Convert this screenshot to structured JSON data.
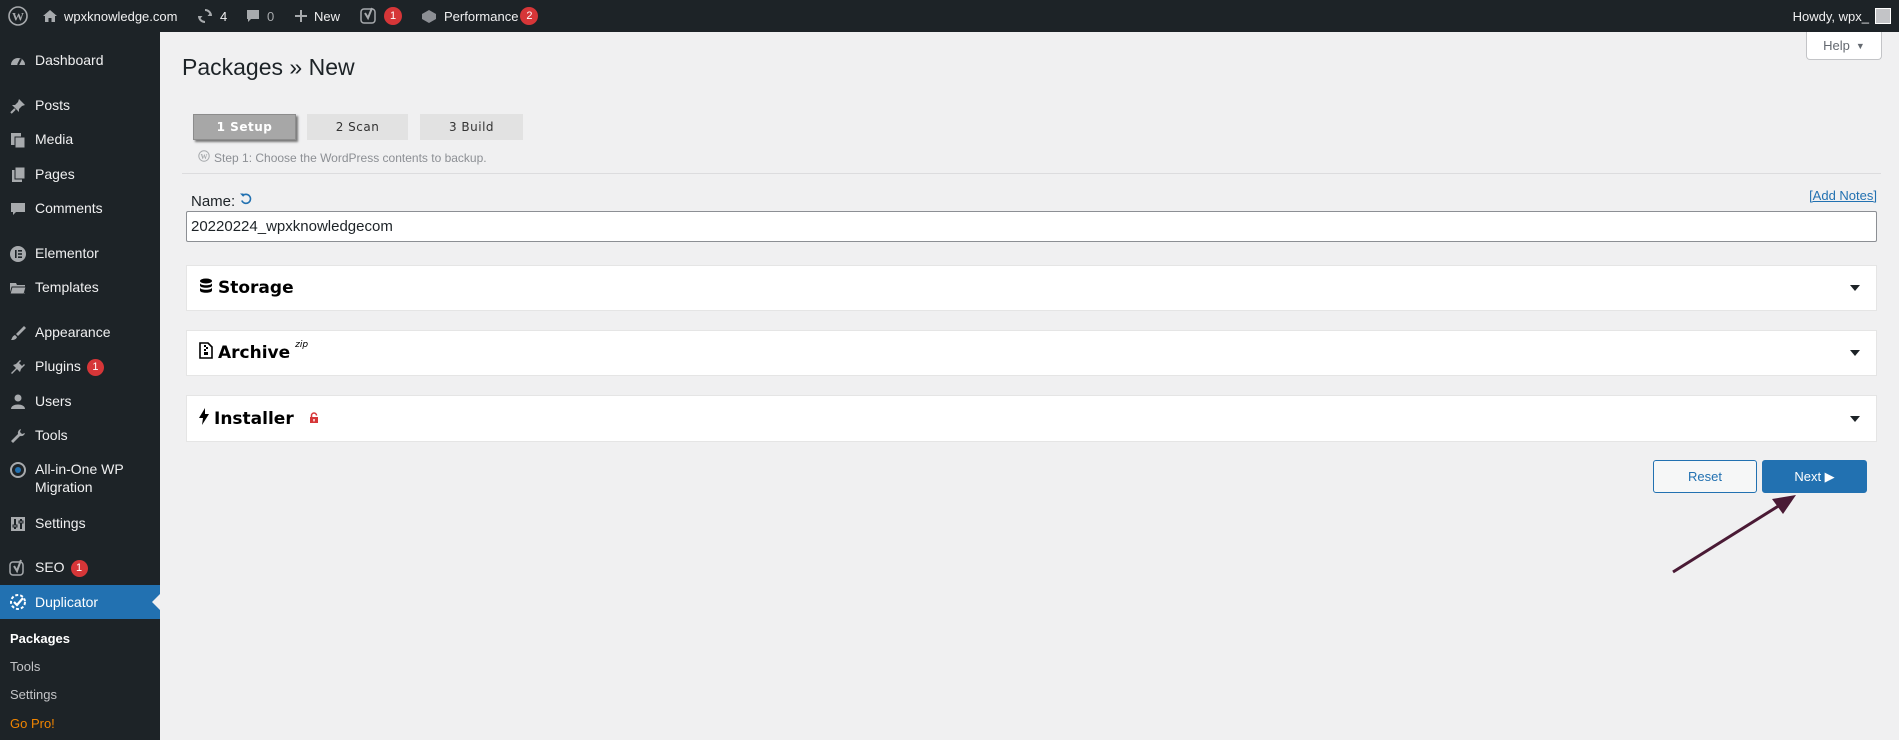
{
  "admin_bar": {
    "site_name": "wpxknowledge.com",
    "updates_count": "4",
    "comments_count": "0",
    "new_label": "New",
    "yoast_badge": "1",
    "performance_label": "Performance",
    "performance_badge": "2",
    "howdy": "Howdy, wpx_"
  },
  "sidebar": {
    "items": [
      {
        "label": "Dashboard",
        "icon": "dashboard-icon"
      },
      {
        "label": "Posts",
        "icon": "pin-icon"
      },
      {
        "label": "Media",
        "icon": "media-icon"
      },
      {
        "label": "Pages",
        "icon": "pages-icon"
      },
      {
        "label": "Comments",
        "icon": "comment-icon"
      },
      {
        "label": "Elementor",
        "icon": "elementor-icon"
      },
      {
        "label": "Templates",
        "icon": "folder-icon"
      },
      {
        "label": "Appearance",
        "icon": "brush-icon"
      },
      {
        "label": "Plugins",
        "icon": "plugin-icon",
        "badge": "1"
      },
      {
        "label": "Users",
        "icon": "user-icon"
      },
      {
        "label": "Tools",
        "icon": "wrench-icon"
      },
      {
        "label": "All-in-One WP Migration",
        "icon": "migration-icon"
      },
      {
        "label": "Settings",
        "icon": "settings-icon"
      },
      {
        "label": "SEO",
        "icon": "yoast-icon",
        "badge": "1"
      },
      {
        "label": "Duplicator",
        "icon": "duplicator-icon"
      }
    ],
    "submenu": [
      {
        "label": "Packages"
      },
      {
        "label": "Tools"
      },
      {
        "label": "Settings"
      },
      {
        "label": "Go Pro!"
      }
    ],
    "accent_color": "#2271b1"
  },
  "page": {
    "title": "Packages » New",
    "help_label": "Help",
    "steps": [
      {
        "label": "1 Setup"
      },
      {
        "label": "2 Scan"
      },
      {
        "label": "3 Build"
      }
    ],
    "step_hint": "Step 1: Choose the WordPress contents to backup.",
    "name_label": "Name:",
    "add_notes": "[Add Notes]",
    "name_value": "20220224_wpxknowledgecom",
    "panels": [
      {
        "title": "Storage",
        "icon": "database-icon"
      },
      {
        "title": "Archive",
        "icon": "file-zip-icon",
        "sup": "zip"
      },
      {
        "title": "Installer",
        "icon": "bolt-icon",
        "extra_icon": "lock-icon"
      }
    ],
    "reset_label": "Reset",
    "next_label": "Next ▶"
  },
  "annotation": {
    "arrow_color": "#4a1a35"
  }
}
